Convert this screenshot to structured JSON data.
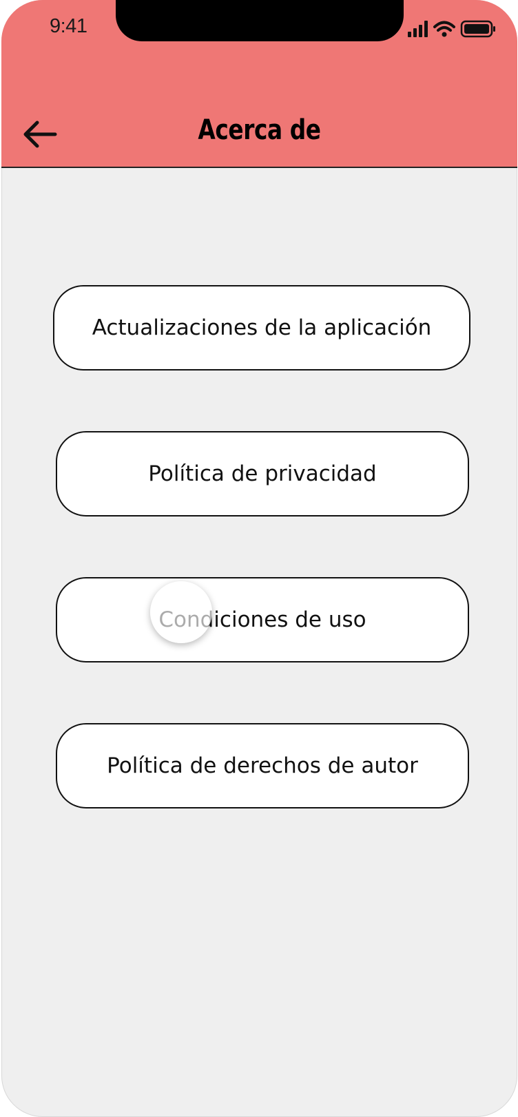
{
  "status_bar": {
    "time": "9:41",
    "icons": [
      "signal-icon",
      "wifi-icon",
      "battery-icon"
    ]
  },
  "header": {
    "title": "Acerca de",
    "back_icon": "arrow-left-icon",
    "background_color": "#ef7775"
  },
  "menu": {
    "items": [
      {
        "label": "Actualizaciones de la aplicación"
      },
      {
        "label": "Política de privacidad"
      },
      {
        "label": "Condiciones de uso"
      },
      {
        "label": "Política de derechos de autor"
      }
    ]
  },
  "colors": {
    "screen_background": "#efefef",
    "button_background": "#ffffff",
    "button_border": "#111111"
  }
}
